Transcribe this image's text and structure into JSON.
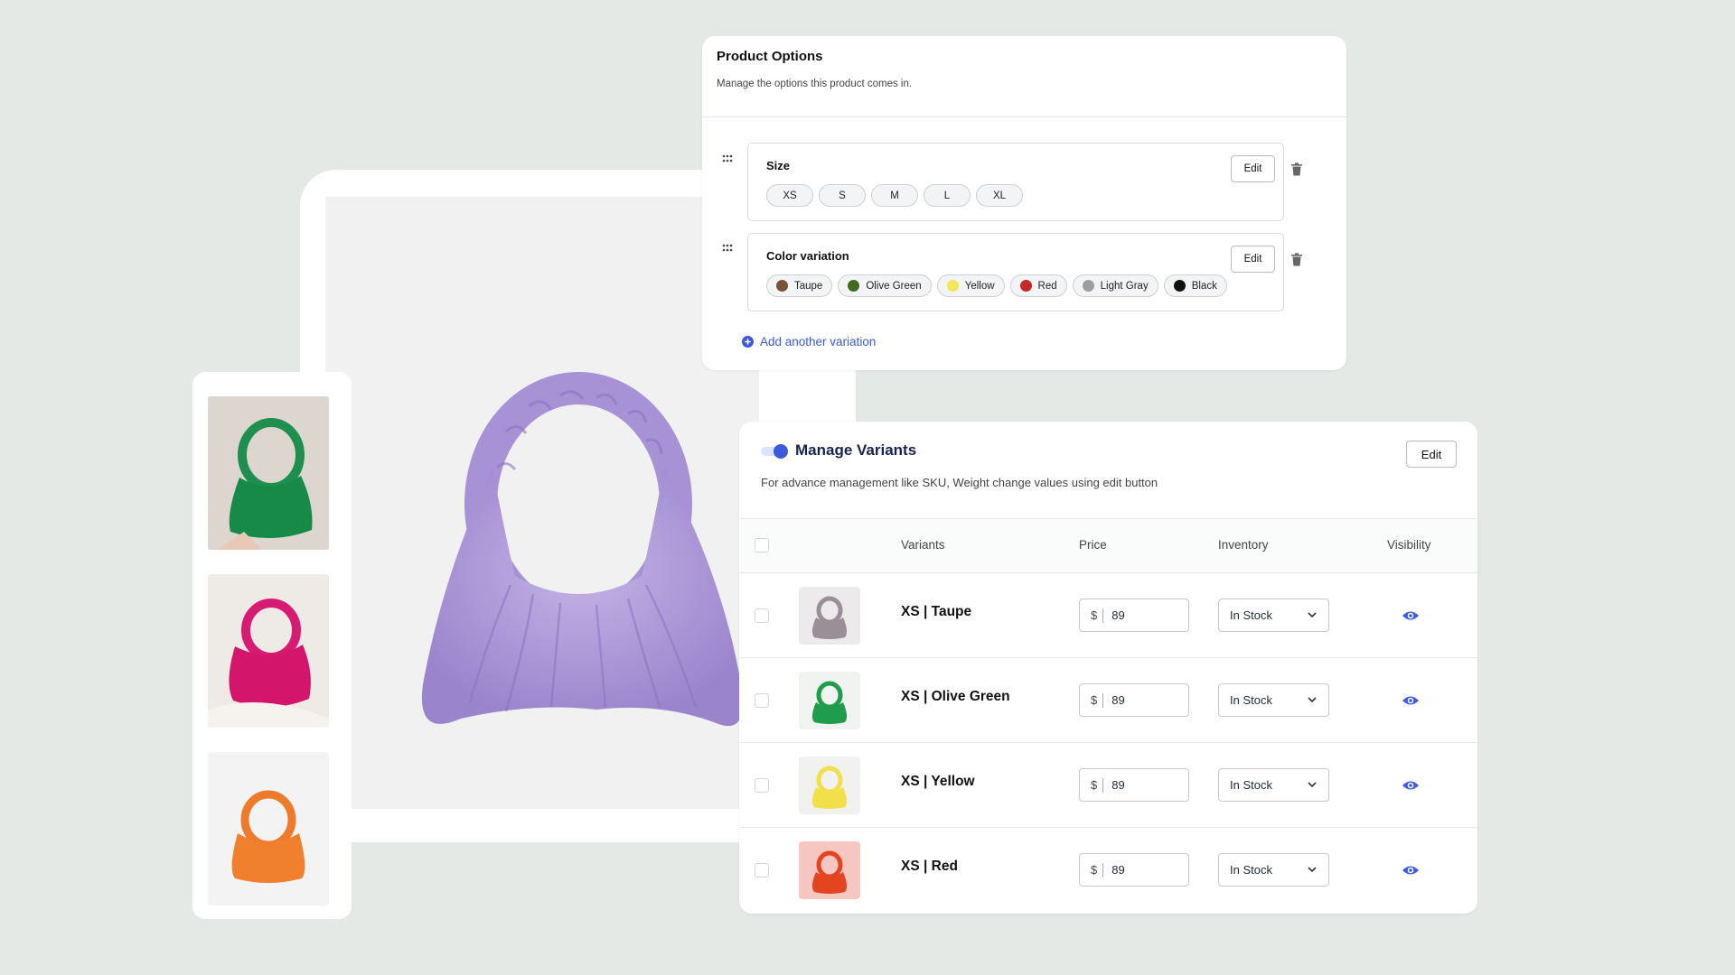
{
  "options": {
    "title": "Product Options",
    "subtitle": "Manage the options this product comes in.",
    "size": {
      "label": "Size",
      "values": [
        "XS",
        "S",
        "M",
        "L",
        "XL"
      ],
      "edit_label": "Edit"
    },
    "color": {
      "label": "Color variation",
      "edit_label": "Edit",
      "values": [
        {
          "name": "Taupe",
          "hex": "#7a5236"
        },
        {
          "name": "Olive Green",
          "hex": "#3e6b1f"
        },
        {
          "name": "Yellow",
          "hex": "#f4e65a"
        },
        {
          "name": "Red",
          "hex": "#c62828"
        },
        {
          "name": "Light Gray",
          "hex": "#9e9e9e"
        },
        {
          "name": "Black",
          "hex": "#111111"
        }
      ]
    },
    "add_variation_label": "Add another variation"
  },
  "variants": {
    "title": "Manage Variants",
    "toggle_on": true,
    "description": "For advance management like SKU, Weight change values using edit button",
    "edit_label": "Edit",
    "columns": {
      "variants": "Variants",
      "price": "Price",
      "inventory": "Inventory",
      "visibility": "Visibility"
    },
    "rows": [
      {
        "name": "XS | Taupe",
        "currency": "$",
        "price": "89",
        "inventory": "In Stock",
        "bag_color": "#9a8f96",
        "bg": "#eceaeb"
      },
      {
        "name": "XS | Olive Green",
        "currency": "$",
        "price": "89",
        "inventory": "In Stock",
        "bag_color": "#1f9d4c",
        "bg": "#f1f3f1"
      },
      {
        "name": "XS | Yellow",
        "currency": "$",
        "price": "89",
        "inventory": "In Stock",
        "bag_color": "#f2e04a",
        "bg": "#f1f1f0"
      },
      {
        "name": "XS | Red",
        "currency": "$",
        "price": "89",
        "inventory": "In Stock",
        "bag_color": "#e2451f",
        "bg": "#f6c7c0"
      }
    ]
  },
  "colors": {
    "accent": "#3b5bdb",
    "main_bag": "#b3a0dc"
  }
}
